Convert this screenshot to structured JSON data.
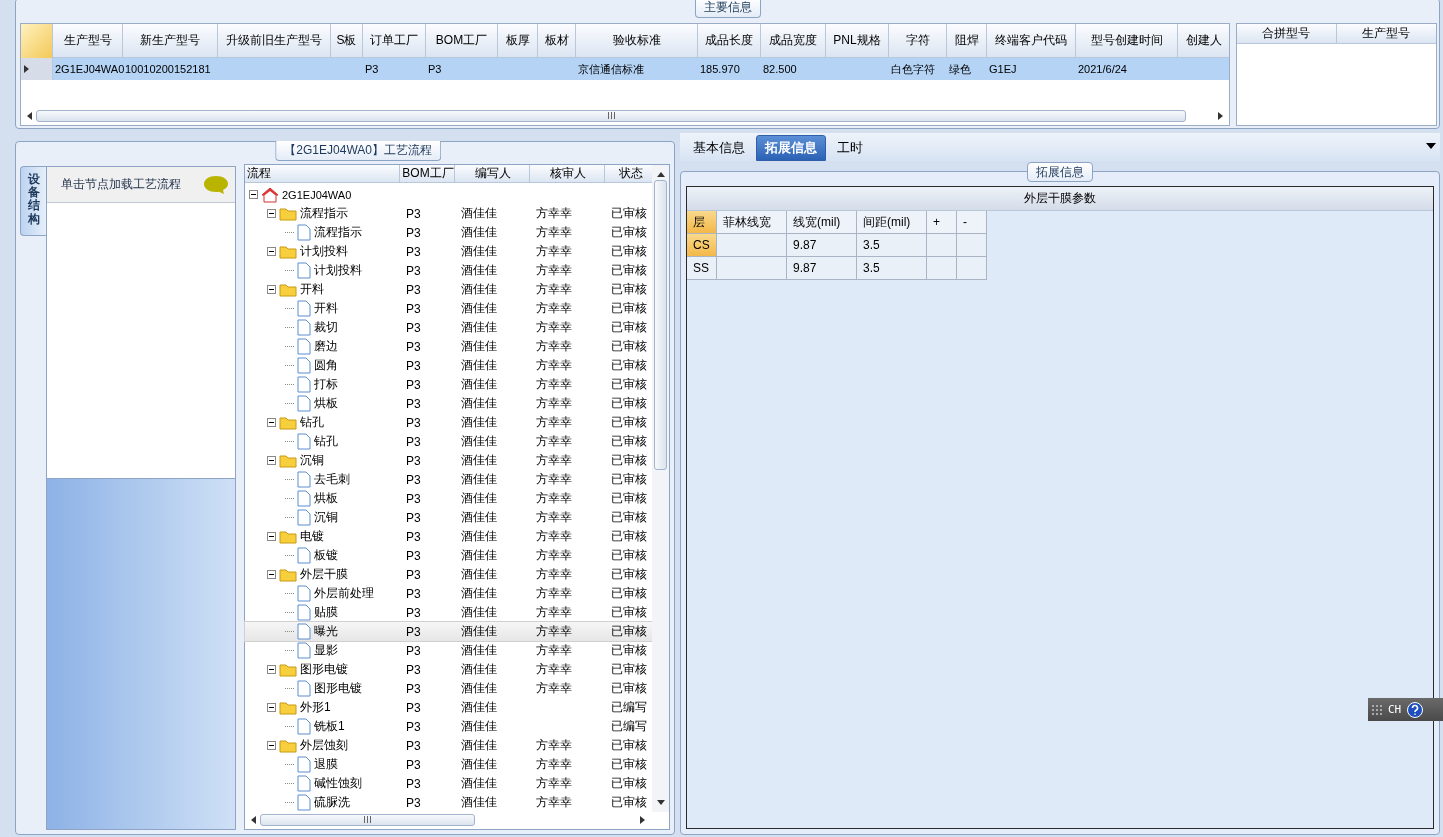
{
  "main_info": {
    "legend": "主要信息",
    "columns": [
      "生产型号",
      "新生产型号",
      "升级前旧生产型号",
      "S板",
      "订单工厂",
      "BOM工厂",
      "板厚",
      "板材",
      "验收标准",
      "成品长度",
      "成品宽度",
      "PNL规格",
      "字符",
      "阻焊",
      "终端客户代码",
      "型号创建时间",
      "创建人"
    ],
    "rows": [
      {
        "selected": true,
        "cells": [
          "2G1EJ04WA0",
          "10010200152181",
          null,
          null,
          "P3",
          "P3",
          null,
          null,
          "京信通信标准",
          "185.970",
          "82.500",
          null,
          "白色字符",
          "绿色",
          "G1EJ",
          "2021/6/24",
          null
        ]
      }
    ]
  },
  "merge_grid": {
    "columns": [
      "合拼型号",
      "生产型号"
    ]
  },
  "process_panel": {
    "legend": "【2G1EJ04WA0】工艺流程",
    "side_tab": "设备结构",
    "hint": "单击节点加载工艺流程",
    "columns": [
      "流程",
      "BOM工厂",
      "编写人",
      "核审人",
      "状态"
    ],
    "tree": [
      {
        "kind": "root",
        "name": "2G1EJ04WA0",
        "expanded": true,
        "selected": false,
        "children": [
          {
            "kind": "folder",
            "name": "流程指示",
            "expanded": true,
            "selected": false,
            "bom": "P3",
            "writer": "酒佳佳",
            "reviewer": "方幸幸",
            "status": "已审核",
            "children": [
              {
                "kind": "file",
                "name": "流程指示",
                "selected": false,
                "bom": "P3",
                "writer": "酒佳佳",
                "reviewer": "方幸幸",
                "status": "已审核"
              }
            ]
          },
          {
            "kind": "folder",
            "name": "计划投料",
            "expanded": true,
            "selected": false,
            "bom": "P3",
            "writer": "酒佳佳",
            "reviewer": "方幸幸",
            "status": "已审核",
            "children": [
              {
                "kind": "file",
                "name": "计划投料",
                "selected": false,
                "bom": "P3",
                "writer": "酒佳佳",
                "reviewer": "方幸幸",
                "status": "已审核"
              }
            ]
          },
          {
            "kind": "folder",
            "name": "开料",
            "expanded": true,
            "selected": false,
            "bom": "P3",
            "writer": "酒佳佳",
            "reviewer": "方幸幸",
            "status": "已审核",
            "children": [
              {
                "kind": "file",
                "name": "开料",
                "selected": false,
                "bom": "P3",
                "writer": "酒佳佳",
                "reviewer": "方幸幸",
                "status": "已审核"
              },
              {
                "kind": "file",
                "name": "裁切",
                "selected": false,
                "bom": "P3",
                "writer": "酒佳佳",
                "reviewer": "方幸幸",
                "status": "已审核"
              },
              {
                "kind": "file",
                "name": "磨边",
                "selected": false,
                "bom": "P3",
                "writer": "酒佳佳",
                "reviewer": "方幸幸",
                "status": "已审核"
              },
              {
                "kind": "file",
                "name": "圆角",
                "selected": false,
                "bom": "P3",
                "writer": "酒佳佳",
                "reviewer": "方幸幸",
                "status": "已审核"
              },
              {
                "kind": "file",
                "name": "打标",
                "selected": false,
                "bom": "P3",
                "writer": "酒佳佳",
                "reviewer": "方幸幸",
                "status": "已审核"
              },
              {
                "kind": "file",
                "name": "烘板",
                "selected": false,
                "bom": "P3",
                "writer": "酒佳佳",
                "reviewer": "方幸幸",
                "status": "已审核"
              }
            ]
          },
          {
            "kind": "folder",
            "name": "钻孔",
            "expanded": true,
            "selected": false,
            "bom": "P3",
            "writer": "酒佳佳",
            "reviewer": "方幸幸",
            "status": "已审核",
            "children": [
              {
                "kind": "file",
                "name": "钻孔",
                "selected": false,
                "bom": "P3",
                "writer": "酒佳佳",
                "reviewer": "方幸幸",
                "status": "已审核"
              }
            ]
          },
          {
            "kind": "folder",
            "name": "沉铜",
            "expanded": true,
            "selected": false,
            "bom": "P3",
            "writer": "酒佳佳",
            "reviewer": "方幸幸",
            "status": "已审核",
            "children": [
              {
                "kind": "file",
                "name": "去毛刺",
                "selected": false,
                "bom": "P3",
                "writer": "酒佳佳",
                "reviewer": "方幸幸",
                "status": "已审核"
              },
              {
                "kind": "file",
                "name": "烘板",
                "selected": false,
                "bom": "P3",
                "writer": "酒佳佳",
                "reviewer": "方幸幸",
                "status": "已审核"
              },
              {
                "kind": "file",
                "name": "沉铜",
                "selected": false,
                "bom": "P3",
                "writer": "酒佳佳",
                "reviewer": "方幸幸",
                "status": "已审核"
              }
            ]
          },
          {
            "kind": "folder",
            "name": "电镀",
            "expanded": true,
            "selected": false,
            "bom": "P3",
            "writer": "酒佳佳",
            "reviewer": "方幸幸",
            "status": "已审核",
            "children": [
              {
                "kind": "file",
                "name": "板镀",
                "selected": false,
                "bom": "P3",
                "writer": "酒佳佳",
                "reviewer": "方幸幸",
                "status": "已审核"
              }
            ]
          },
          {
            "kind": "folder",
            "name": "外层干膜",
            "expanded": true,
            "selected": false,
            "bom": "P3",
            "writer": "酒佳佳",
            "reviewer": "方幸幸",
            "status": "已审核",
            "children": [
              {
                "kind": "file",
                "name": "外层前处理",
                "selected": false,
                "bom": "P3",
                "writer": "酒佳佳",
                "reviewer": "方幸幸",
                "status": "已审核"
              },
              {
                "kind": "file",
                "name": "贴膜",
                "selected": false,
                "bom": "P3",
                "writer": "酒佳佳",
                "reviewer": "方幸幸",
                "status": "已审核"
              },
              {
                "kind": "file",
                "name": "曝光",
                "selected": true,
                "bom": "P3",
                "writer": "酒佳佳",
                "reviewer": "方幸幸",
                "status": "已审核"
              },
              {
                "kind": "file",
                "name": "显影",
                "selected": false,
                "bom": "P3",
                "writer": "酒佳佳",
                "reviewer": "方幸幸",
                "status": "已审核"
              }
            ]
          },
          {
            "kind": "folder",
            "name": "图形电镀",
            "expanded": true,
            "selected": false,
            "bom": "P3",
            "writer": "酒佳佳",
            "reviewer": "方幸幸",
            "status": "已审核",
            "children": [
              {
                "kind": "file",
                "name": "图形电镀",
                "selected": false,
                "bom": "P3",
                "writer": "酒佳佳",
                "reviewer": "方幸幸",
                "status": "已审核"
              }
            ]
          },
          {
            "kind": "folder",
            "name": "外形1",
            "expanded": true,
            "selected": false,
            "bom": "P3",
            "writer": "酒佳佳",
            "status": "已编写",
            "children": [
              {
                "kind": "file",
                "name": "铣板1",
                "selected": false,
                "bom": "P3",
                "writer": "酒佳佳",
                "status": "已编写"
              }
            ]
          },
          {
            "kind": "folder",
            "name": "外层蚀刻",
            "expanded": true,
            "selected": false,
            "bom": "P3",
            "writer": "酒佳佳",
            "reviewer": "方幸幸",
            "status": "已审核",
            "children": [
              {
                "kind": "file",
                "name": "退膜",
                "selected": false,
                "bom": "P3",
                "writer": "酒佳佳",
                "reviewer": "方幸幸",
                "status": "已审核"
              },
              {
                "kind": "file",
                "name": "碱性蚀刻",
                "selected": false,
                "bom": "P3",
                "writer": "酒佳佳",
                "reviewer": "方幸幸",
                "status": "已审核"
              },
              {
                "kind": "file",
                "name": "硫脲洗",
                "selected": false,
                "bom": "P3",
                "writer": "酒佳佳",
                "reviewer": "方幸幸",
                "status": "已审核"
              }
            ]
          }
        ]
      }
    ]
  },
  "detail_tabs": [
    {
      "label": "基本信息",
      "selected": false
    },
    {
      "label": "拓展信息",
      "selected": true
    },
    {
      "label": "工时",
      "selected": false
    }
  ],
  "ext_info": {
    "legend": "拓展信息",
    "table_title": "外层干膜参数",
    "columns": [
      "层",
      "菲林线宽",
      "线宽(mil)",
      "间距(mil)",
      "+",
      "-"
    ],
    "rows": [
      {
        "selected": true,
        "cells": [
          "CS",
          null,
          "9.87",
          "3.5",
          null,
          null
        ]
      },
      {
        "selected": false,
        "cells": [
          "SS",
          null,
          "9.87",
          "3.5",
          null,
          null
        ]
      }
    ]
  },
  "language_bar": {
    "label": "CH"
  }
}
